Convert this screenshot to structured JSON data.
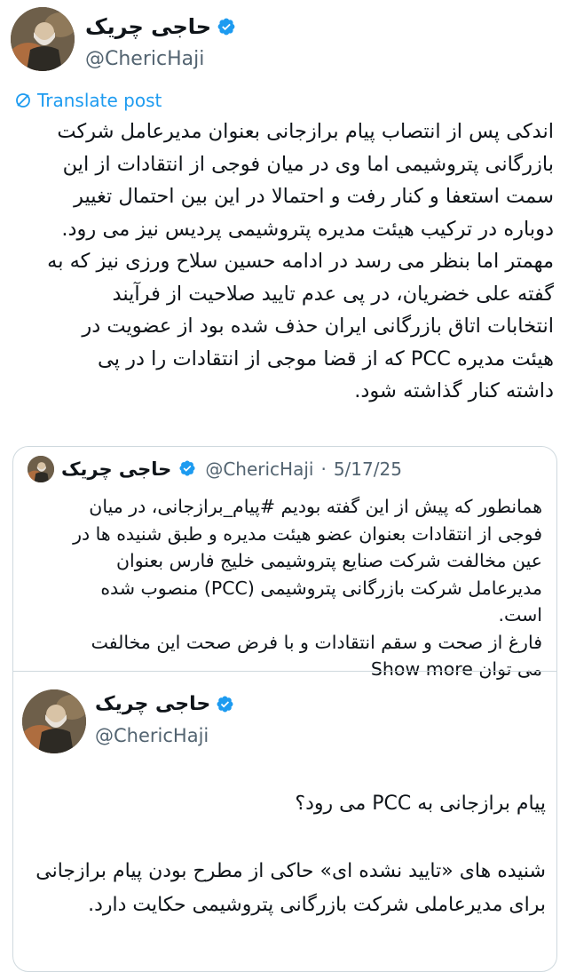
{
  "author": {
    "display_name": "حاجی چریک",
    "handle": "@ChericHaji",
    "verified": true,
    "avatar": "person-in-front-of-fire"
  },
  "translate_label": "Translate post",
  "post": {
    "text": "اندکی پس از انتصاب پیام برازجانی بعنوان مدیرعامل شرکت\nبازرگانی پتروشیمی اما وی در میان فوجی از انتقادات از این\nسمت استعفا و کنار رفت و احتمالا در این بین احتمال تغییر\nدوباره در ترکیب هیئت مدیره پتروشیمی پردیس نیز می رود.\nمهمتر اما بنظر می رسد در ادامه حسین سلاح ورزی نیز که به\nگفته علی خضریان، در پی عدم تایید صلاحیت از فرآیند\nانتخابات اتاق بازرگانی ایران حذف شده بود از عضویت در\nهیئت مدیره PCC که از قضا موجی از انتقادات را در پی\nداشته کنار گذاشته شود."
  },
  "quoted": {
    "display_name": "حاجی چریک",
    "handle": "@ChericHaji",
    "separator": "·",
    "date": "5/17/25",
    "text": "همانطور که پیش از این گفته بودیم #پیام_برازجانی، در میان\nفوجی از انتقادات بعنوان عضو هیئت مدیره و طبق شنیده ها در\nعین مخالفت شرکت صنایع پتروشیمی خلیج فارس بعنوان\nمدیرعامل شرکت بازرگانی پتروشیمی (PCC) منصوب شده\nاست.\nفارغ از صحت و سقم انتقادات و با فرض صحت این مخالفت\nمی توان",
    "show_more_label": "Show more"
  },
  "inner": {
    "display_name": "حاجی چریک",
    "handle": "@ChericHaji",
    "question": "پیام برازجانی به PCC می رود؟",
    "paragraph": "شنیده های «تایید نشده ای» حاکی از مطرح بودن پیام برازجانی برای مدیرعاملی شرکت بازرگانی پتروشیمی حکایت دارد."
  },
  "colors": {
    "verified": "#1d9bf0",
    "link": "#1d9bf0",
    "secondary_text": "#536471",
    "border": "#cfd9de"
  }
}
